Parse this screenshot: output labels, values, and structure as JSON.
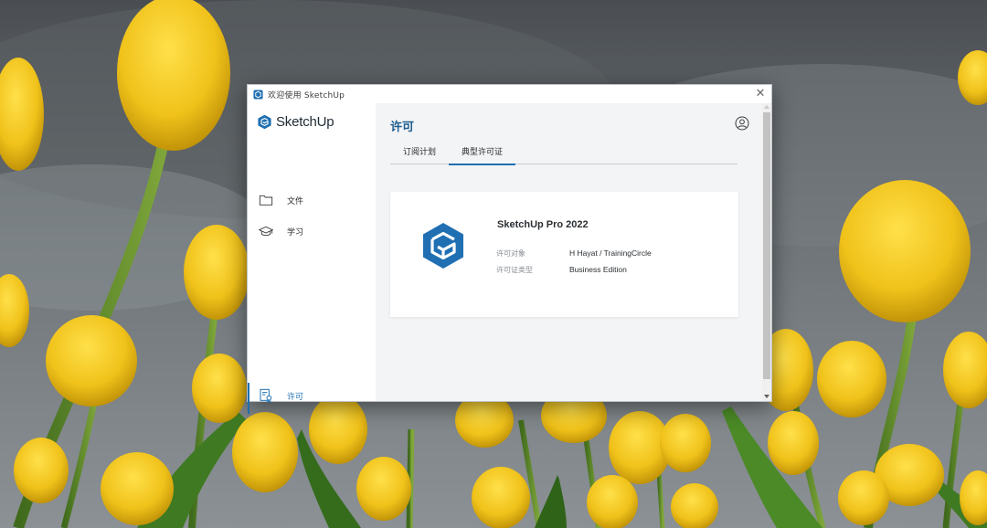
{
  "window": {
    "title": "欢迎使用 SketchUp",
    "close_glyph": "✕"
  },
  "sidebar": {
    "brand": "SketchUp",
    "items": [
      {
        "label": "文件",
        "icon": "folder-icon"
      },
      {
        "label": "学习",
        "icon": "graduation-cap-icon"
      },
      {
        "label": "许可",
        "icon": "license-icon",
        "active": true
      }
    ]
  },
  "main": {
    "title": "许可",
    "tabs": [
      {
        "label": "订阅计划",
        "active": false
      },
      {
        "label": "典型许可证",
        "active": true
      }
    ],
    "license": {
      "product": "SketchUp Pro 2022",
      "fields": [
        {
          "label": "许可对象",
          "value": "H Hayat / TrainingCircle"
        },
        {
          "label": "许可证类型",
          "value": "Business Edition"
        }
      ]
    }
  },
  "colors": {
    "accent": "#1e6fb0",
    "title_blue": "#1e5c8d",
    "logo_blue": "#1f6fb2"
  }
}
